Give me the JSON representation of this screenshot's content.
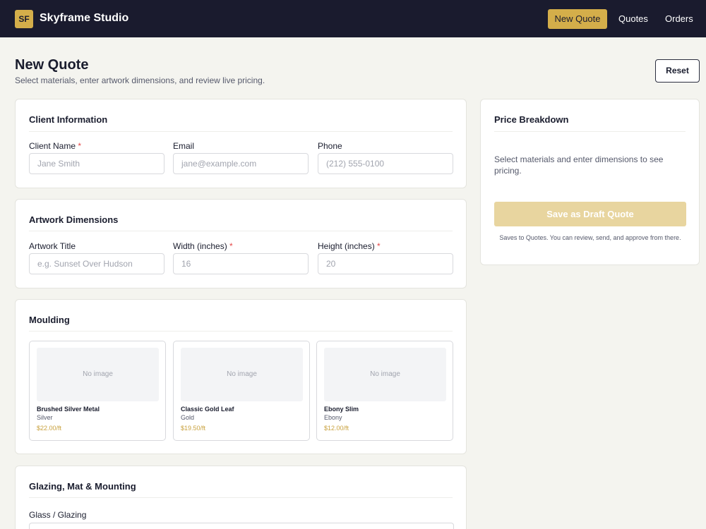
{
  "header": {
    "logo_text": "SF",
    "brand": "Skyframe Studio",
    "nav": {
      "new_quote": "New Quote",
      "quotes": "Quotes",
      "orders": "Orders"
    }
  },
  "page": {
    "title": "New Quote",
    "subtitle": "Select materials, enter artwork dimensions, and review live pricing.",
    "reset_label": "Reset"
  },
  "client": {
    "title": "Client Information",
    "name_label": "Client Name",
    "name_placeholder": "Jane Smith",
    "email_label": "Email",
    "email_placeholder": "jane@example.com",
    "phone_label": "Phone",
    "phone_placeholder": "(212) 555-0100"
  },
  "artwork": {
    "title": "Artwork Dimensions",
    "title_label": "Artwork Title",
    "title_placeholder": "e.g. Sunset Over Hudson",
    "width_label": "Width (inches)",
    "width_placeholder": "16",
    "height_label": "Height (inches)",
    "height_placeholder": "20"
  },
  "required_mark": "*",
  "moulding": {
    "title": "Moulding",
    "items": [
      {
        "no_image": "No image",
        "name": "Brushed Silver Metal",
        "finish": "Silver",
        "price": "$22.00/ft"
      },
      {
        "no_image": "No image",
        "name": "Classic Gold Leaf",
        "finish": "Gold",
        "price": "$19.50/ft"
      },
      {
        "no_image": "No image",
        "name": "Ebony Slim",
        "finish": "Ebony",
        "price": "$12.00/ft"
      }
    ]
  },
  "glazing": {
    "title": "Glazing, Mat & Mounting",
    "glass_label": "Glass / Glazing"
  },
  "price": {
    "title": "Price Breakdown",
    "empty_text": "Select materials and enter dimensions to see pricing.",
    "save_label": "Save as Draft Quote",
    "save_note": "Saves to Quotes. You can review, send, and approve from there."
  },
  "colors": {
    "topbar": "#1a1b2e",
    "accent": "#d4ae4a",
    "required": "#e54848",
    "price_text": "#c9a23f"
  }
}
